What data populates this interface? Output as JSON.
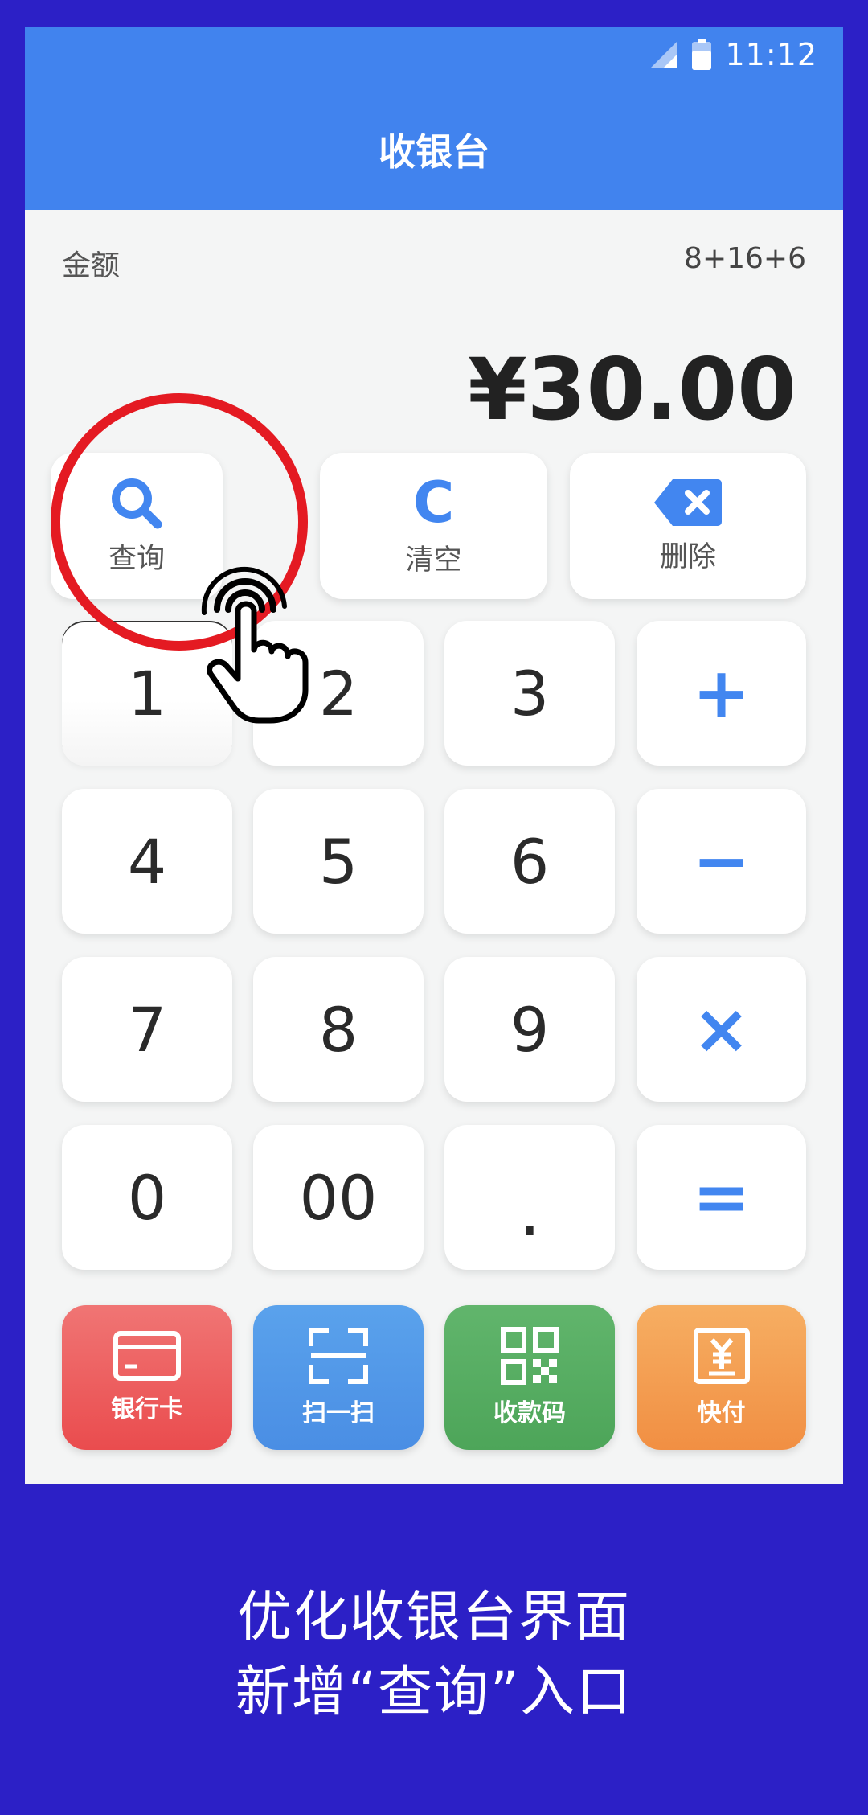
{
  "status_bar": {
    "time": "11:12",
    "icons": [
      "signal-icon",
      "battery-icon"
    ]
  },
  "app_bar": {
    "title": "收银台"
  },
  "amount": {
    "label": "金额",
    "expression": "8+16+6",
    "total": "¥30.00"
  },
  "function_keys": {
    "query": "查询",
    "clear": "清空",
    "delete": "删除",
    "clear_glyph": "C"
  },
  "keypad": {
    "rows": [
      [
        "1",
        "2",
        "3",
        "+"
      ],
      [
        "4",
        "5",
        "6",
        "−"
      ],
      [
        "7",
        "8",
        "9",
        "×"
      ],
      [
        "0",
        "00",
        ".",
        "="
      ]
    ]
  },
  "payment_methods": [
    "银行卡",
    "扫一扫",
    "收款码",
    "快付"
  ],
  "caption": {
    "line1": "优化收银台界面",
    "line2": "新增“查询”入口"
  },
  "colors": {
    "page_background": "#2c20c6",
    "app_bar": "#4183ee",
    "accent_blue": "#4286f0",
    "highlight_red": "#e41a22",
    "bank_card": "#ea4c4e",
    "scan": "#4a8ee4",
    "qr_code": "#4da559",
    "fast_pay": "#f18f43"
  }
}
